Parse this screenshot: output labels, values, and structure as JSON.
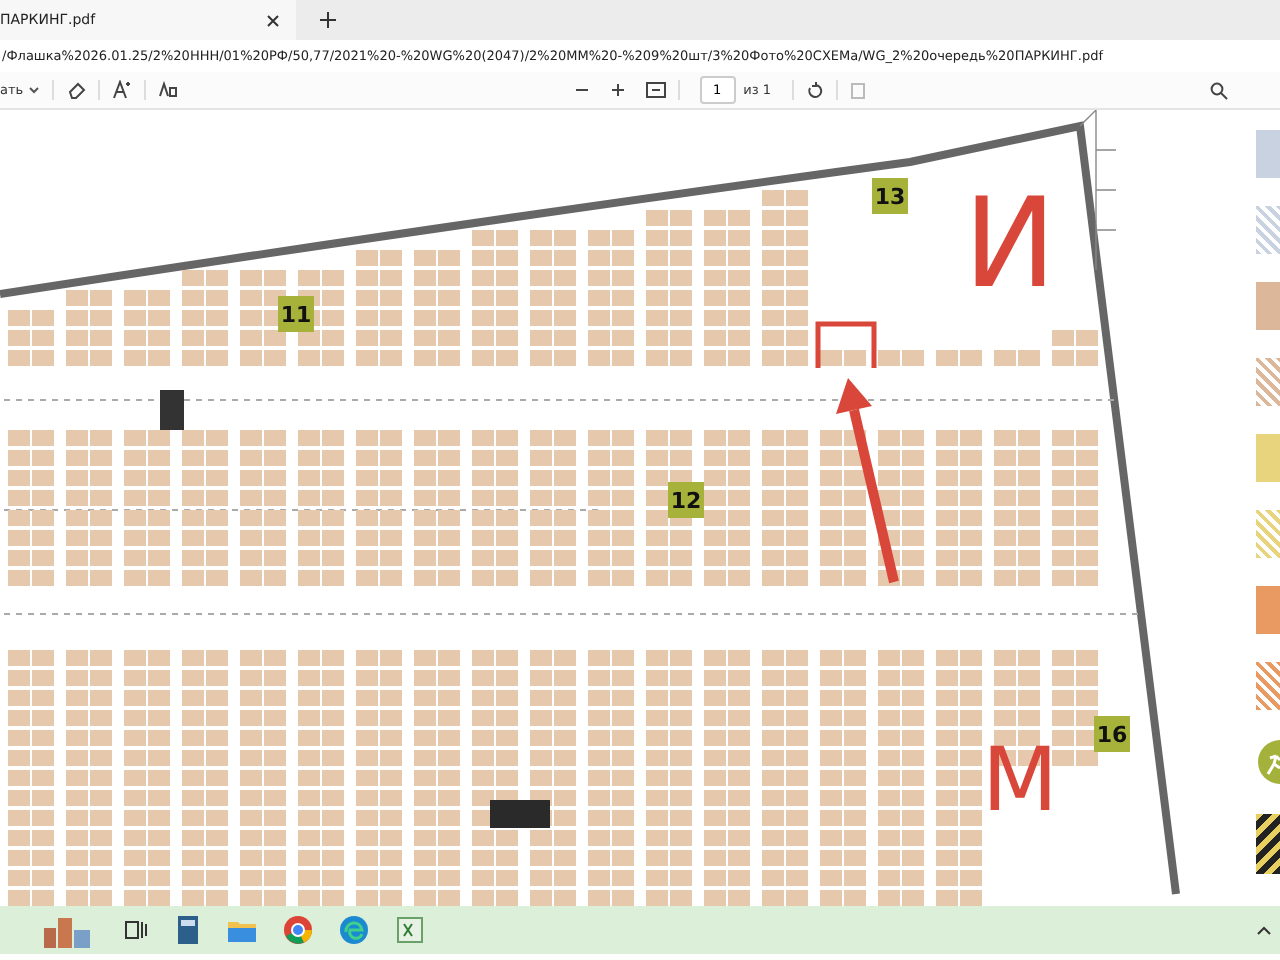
{
  "tab": {
    "title": "ПАРКИНГ.pdf"
  },
  "address": "/Флашка%2026.01.25/2%20ННН/01%20РФ/50,77/2021%20-%20WG%20(2047)/2%20ММ%20-%209%20шт/3%20Фото%20СХЕМа/WG_2%20очередь%20ПАРКИНГ.pdf",
  "toolbar": {
    "draw_label": "ать",
    "page": "1",
    "page_total": "из 1"
  },
  "map": {
    "zones": [
      {
        "label": "11"
      },
      {
        "label": "12"
      },
      {
        "label": "13"
      },
      {
        "label": "16"
      }
    ],
    "sections": [
      {
        "label": "И"
      },
      {
        "label": "М"
      }
    ]
  },
  "legend": [
    {
      "kind": "solid",
      "color": "#c9d2e0"
    },
    {
      "kind": "hatched",
      "color": "#c9d2e0"
    },
    {
      "kind": "solid",
      "color": "#dcb79a"
    },
    {
      "kind": "hatched",
      "color": "#dcb79a"
    },
    {
      "kind": "solid",
      "color": "#e8d47c"
    },
    {
      "kind": "hatched",
      "color": "#e8d47c"
    },
    {
      "kind": "solid",
      "color": "#e99a62"
    },
    {
      "kind": "hatched",
      "color": "#e99a62"
    },
    {
      "kind": "exit",
      "color": "#a4b23c"
    },
    {
      "kind": "hazard",
      "color": "#e8d060"
    }
  ]
}
